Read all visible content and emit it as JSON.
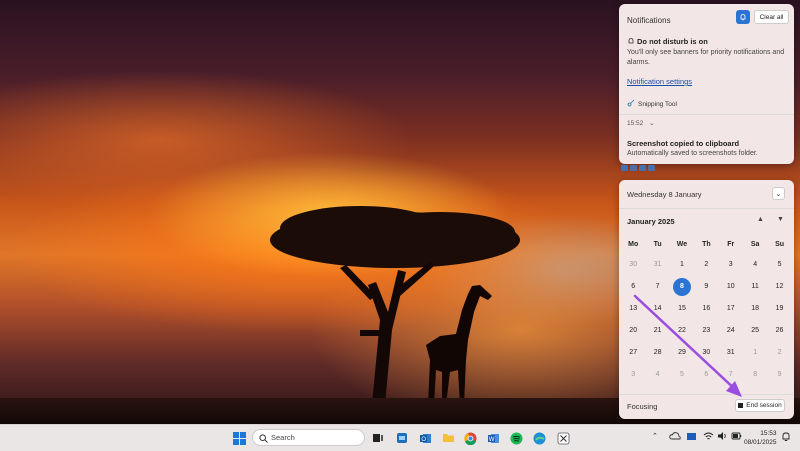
{
  "notifications": {
    "header": "Notifications",
    "clear_all": "Clear all",
    "dnd_title": "Do not disturb is on",
    "dnd_desc": "You'll only see banners for priority notifications and alarms.",
    "settings_link": "Notification settings",
    "app_name": "Snipping Tool",
    "time": "15:52",
    "shot_title": "Screenshot copied to clipboard",
    "shot_desc": "Automatically saved to screenshots folder."
  },
  "calendar": {
    "date_header": "Wednesday 8 January",
    "month": "January 2025",
    "weekdays": [
      "Mo",
      "Tu",
      "We",
      "Th",
      "Fr",
      "Sa",
      "Su"
    ],
    "weeks": [
      [
        "30",
        "31",
        "1",
        "2",
        "3",
        "4",
        "5"
      ],
      [
        "6",
        "7",
        "8",
        "9",
        "10",
        "11",
        "12"
      ],
      [
        "13",
        "14",
        "15",
        "16",
        "17",
        "18",
        "19"
      ],
      [
        "20",
        "21",
        "22",
        "23",
        "24",
        "25",
        "26"
      ],
      [
        "27",
        "28",
        "29",
        "30",
        "31",
        "1",
        "2"
      ],
      [
        "3",
        "4",
        "5",
        "6",
        "7",
        "8",
        "9"
      ]
    ],
    "dim_cells": [
      "0-0",
      "0-1",
      "4-5",
      "4-6",
      "5-0",
      "5-1",
      "5-2",
      "5-3",
      "5-4",
      "5-5",
      "5-6"
    ],
    "today": "1-2",
    "focus_label": "Focusing",
    "end_session": "End session"
  },
  "taskbar": {
    "search_placeholder": "Search",
    "time": "15:53",
    "date": "08/01/2025"
  },
  "colors": {
    "accent": "#2b74d4",
    "annotation": "#9b4de0"
  }
}
